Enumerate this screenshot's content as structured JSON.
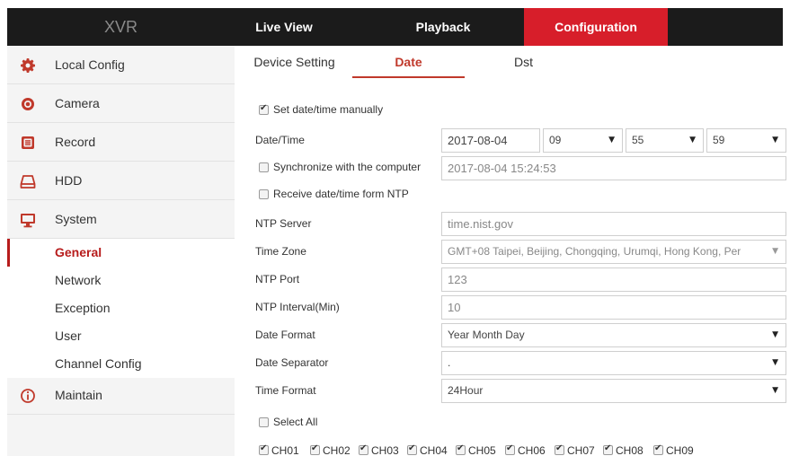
{
  "brand": "XVR",
  "nav": {
    "live_view": "Live View",
    "playback": "Playback",
    "configuration": "Configuration"
  },
  "sidebar": {
    "items": [
      {
        "label": "Local Config",
        "icon": "gear-icon"
      },
      {
        "label": "Camera",
        "icon": "camera-icon"
      },
      {
        "label": "Record",
        "icon": "record-icon"
      },
      {
        "label": "HDD",
        "icon": "hdd-icon"
      },
      {
        "label": "System",
        "icon": "monitor-icon"
      }
    ],
    "system_sub": [
      "General",
      "Network",
      "Exception",
      "User",
      "Channel Config"
    ],
    "maintain": {
      "label": "Maintain",
      "icon": "info-icon"
    }
  },
  "tabs": {
    "device_setting": "Device Setting",
    "date": "Date",
    "dst": "Dst"
  },
  "form": {
    "set_manually": "Set date/time manually",
    "datetime_label": "Date/Time",
    "date_value": "2017-08-04",
    "hour": "09",
    "minute": "55",
    "second": "59",
    "sync_computer": "Synchronize with the computer",
    "computer_time": "2017-08-04 15:24:53",
    "receive_ntp": "Receive date/time form NTP",
    "ntp_server_label": "NTP Server",
    "ntp_server": "time.nist.gov",
    "time_zone_label": "Time Zone",
    "time_zone": "GMT+08 Taipei, Beijing, Chongqing, Urumqi, Hong Kong, Per",
    "ntp_port_label": "NTP Port",
    "ntp_port": "123",
    "ntp_interval_label": "NTP Interval(Min)",
    "ntp_interval": "10",
    "date_format_label": "Date Format",
    "date_format": "Year Month Day",
    "date_separator_label": "Date Separator",
    "date_separator": ".",
    "time_format_label": "Time Format",
    "time_format": "24Hour",
    "select_all": "Select All",
    "channels": [
      "CH01",
      "CH02",
      "CH03",
      "CH04",
      "CH05",
      "CH06",
      "CH07",
      "CH08",
      "CH09"
    ]
  },
  "colors": {
    "accent": "#d71e2a",
    "topbar": "#1b1b1b",
    "sidebar": "#f4f4f4"
  }
}
